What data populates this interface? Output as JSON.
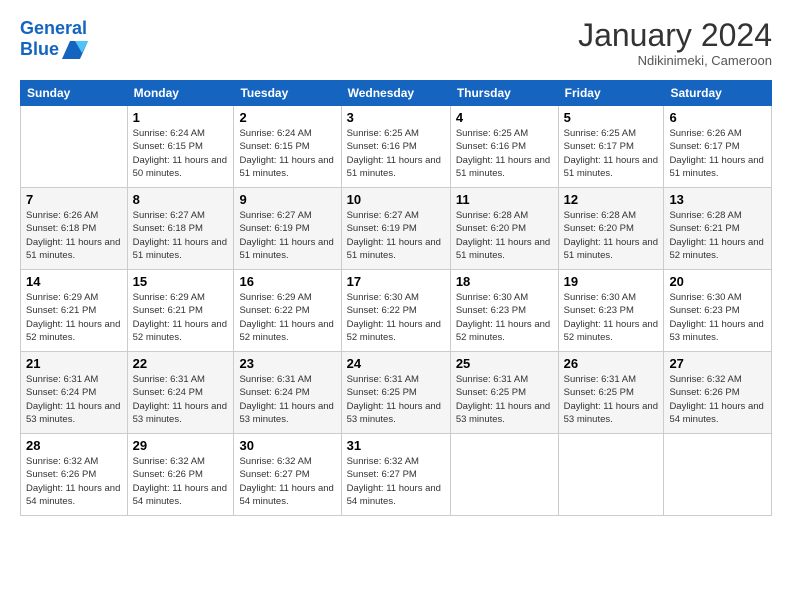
{
  "header": {
    "logo_line1": "General",
    "logo_line2": "Blue",
    "month_title": "January 2024",
    "location": "Ndikinimeki, Cameroon"
  },
  "weekdays": [
    "Sunday",
    "Monday",
    "Tuesday",
    "Wednesday",
    "Thursday",
    "Friday",
    "Saturday"
  ],
  "weeks": [
    [
      {
        "day": "",
        "sunrise": "",
        "sunset": "",
        "daylight": ""
      },
      {
        "day": "1",
        "sunrise": "6:24 AM",
        "sunset": "6:15 PM",
        "daylight": "11 hours and 50 minutes."
      },
      {
        "day": "2",
        "sunrise": "6:24 AM",
        "sunset": "6:15 PM",
        "daylight": "11 hours and 51 minutes."
      },
      {
        "day": "3",
        "sunrise": "6:25 AM",
        "sunset": "6:16 PM",
        "daylight": "11 hours and 51 minutes."
      },
      {
        "day": "4",
        "sunrise": "6:25 AM",
        "sunset": "6:16 PM",
        "daylight": "11 hours and 51 minutes."
      },
      {
        "day": "5",
        "sunrise": "6:25 AM",
        "sunset": "6:17 PM",
        "daylight": "11 hours and 51 minutes."
      },
      {
        "day": "6",
        "sunrise": "6:26 AM",
        "sunset": "6:17 PM",
        "daylight": "11 hours and 51 minutes."
      }
    ],
    [
      {
        "day": "7",
        "sunrise": "6:26 AM",
        "sunset": "6:18 PM",
        "daylight": "11 hours and 51 minutes."
      },
      {
        "day": "8",
        "sunrise": "6:27 AM",
        "sunset": "6:18 PM",
        "daylight": "11 hours and 51 minutes."
      },
      {
        "day": "9",
        "sunrise": "6:27 AM",
        "sunset": "6:19 PM",
        "daylight": "11 hours and 51 minutes."
      },
      {
        "day": "10",
        "sunrise": "6:27 AM",
        "sunset": "6:19 PM",
        "daylight": "11 hours and 51 minutes."
      },
      {
        "day": "11",
        "sunrise": "6:28 AM",
        "sunset": "6:20 PM",
        "daylight": "11 hours and 51 minutes."
      },
      {
        "day": "12",
        "sunrise": "6:28 AM",
        "sunset": "6:20 PM",
        "daylight": "11 hours and 51 minutes."
      },
      {
        "day": "13",
        "sunrise": "6:28 AM",
        "sunset": "6:21 PM",
        "daylight": "11 hours and 52 minutes."
      }
    ],
    [
      {
        "day": "14",
        "sunrise": "6:29 AM",
        "sunset": "6:21 PM",
        "daylight": "11 hours and 52 minutes."
      },
      {
        "day": "15",
        "sunrise": "6:29 AM",
        "sunset": "6:21 PM",
        "daylight": "11 hours and 52 minutes."
      },
      {
        "day": "16",
        "sunrise": "6:29 AM",
        "sunset": "6:22 PM",
        "daylight": "11 hours and 52 minutes."
      },
      {
        "day": "17",
        "sunrise": "6:30 AM",
        "sunset": "6:22 PM",
        "daylight": "11 hours and 52 minutes."
      },
      {
        "day": "18",
        "sunrise": "6:30 AM",
        "sunset": "6:23 PM",
        "daylight": "11 hours and 52 minutes."
      },
      {
        "day": "19",
        "sunrise": "6:30 AM",
        "sunset": "6:23 PM",
        "daylight": "11 hours and 52 minutes."
      },
      {
        "day": "20",
        "sunrise": "6:30 AM",
        "sunset": "6:23 PM",
        "daylight": "11 hours and 53 minutes."
      }
    ],
    [
      {
        "day": "21",
        "sunrise": "6:31 AM",
        "sunset": "6:24 PM",
        "daylight": "11 hours and 53 minutes."
      },
      {
        "day": "22",
        "sunrise": "6:31 AM",
        "sunset": "6:24 PM",
        "daylight": "11 hours and 53 minutes."
      },
      {
        "day": "23",
        "sunrise": "6:31 AM",
        "sunset": "6:24 PM",
        "daylight": "11 hours and 53 minutes."
      },
      {
        "day": "24",
        "sunrise": "6:31 AM",
        "sunset": "6:25 PM",
        "daylight": "11 hours and 53 minutes."
      },
      {
        "day": "25",
        "sunrise": "6:31 AM",
        "sunset": "6:25 PM",
        "daylight": "11 hours and 53 minutes."
      },
      {
        "day": "26",
        "sunrise": "6:31 AM",
        "sunset": "6:25 PM",
        "daylight": "11 hours and 53 minutes."
      },
      {
        "day": "27",
        "sunrise": "6:32 AM",
        "sunset": "6:26 PM",
        "daylight": "11 hours and 54 minutes."
      }
    ],
    [
      {
        "day": "28",
        "sunrise": "6:32 AM",
        "sunset": "6:26 PM",
        "daylight": "11 hours and 54 minutes."
      },
      {
        "day": "29",
        "sunrise": "6:32 AM",
        "sunset": "6:26 PM",
        "daylight": "11 hours and 54 minutes."
      },
      {
        "day": "30",
        "sunrise": "6:32 AM",
        "sunset": "6:27 PM",
        "daylight": "11 hours and 54 minutes."
      },
      {
        "day": "31",
        "sunrise": "6:32 AM",
        "sunset": "6:27 PM",
        "daylight": "11 hours and 54 minutes."
      },
      {
        "day": "",
        "sunrise": "",
        "sunset": "",
        "daylight": ""
      },
      {
        "day": "",
        "sunrise": "",
        "sunset": "",
        "daylight": ""
      },
      {
        "day": "",
        "sunrise": "",
        "sunset": "",
        "daylight": ""
      }
    ]
  ],
  "labels": {
    "sunrise": "Sunrise:",
    "sunset": "Sunset:",
    "daylight": "Daylight:"
  }
}
